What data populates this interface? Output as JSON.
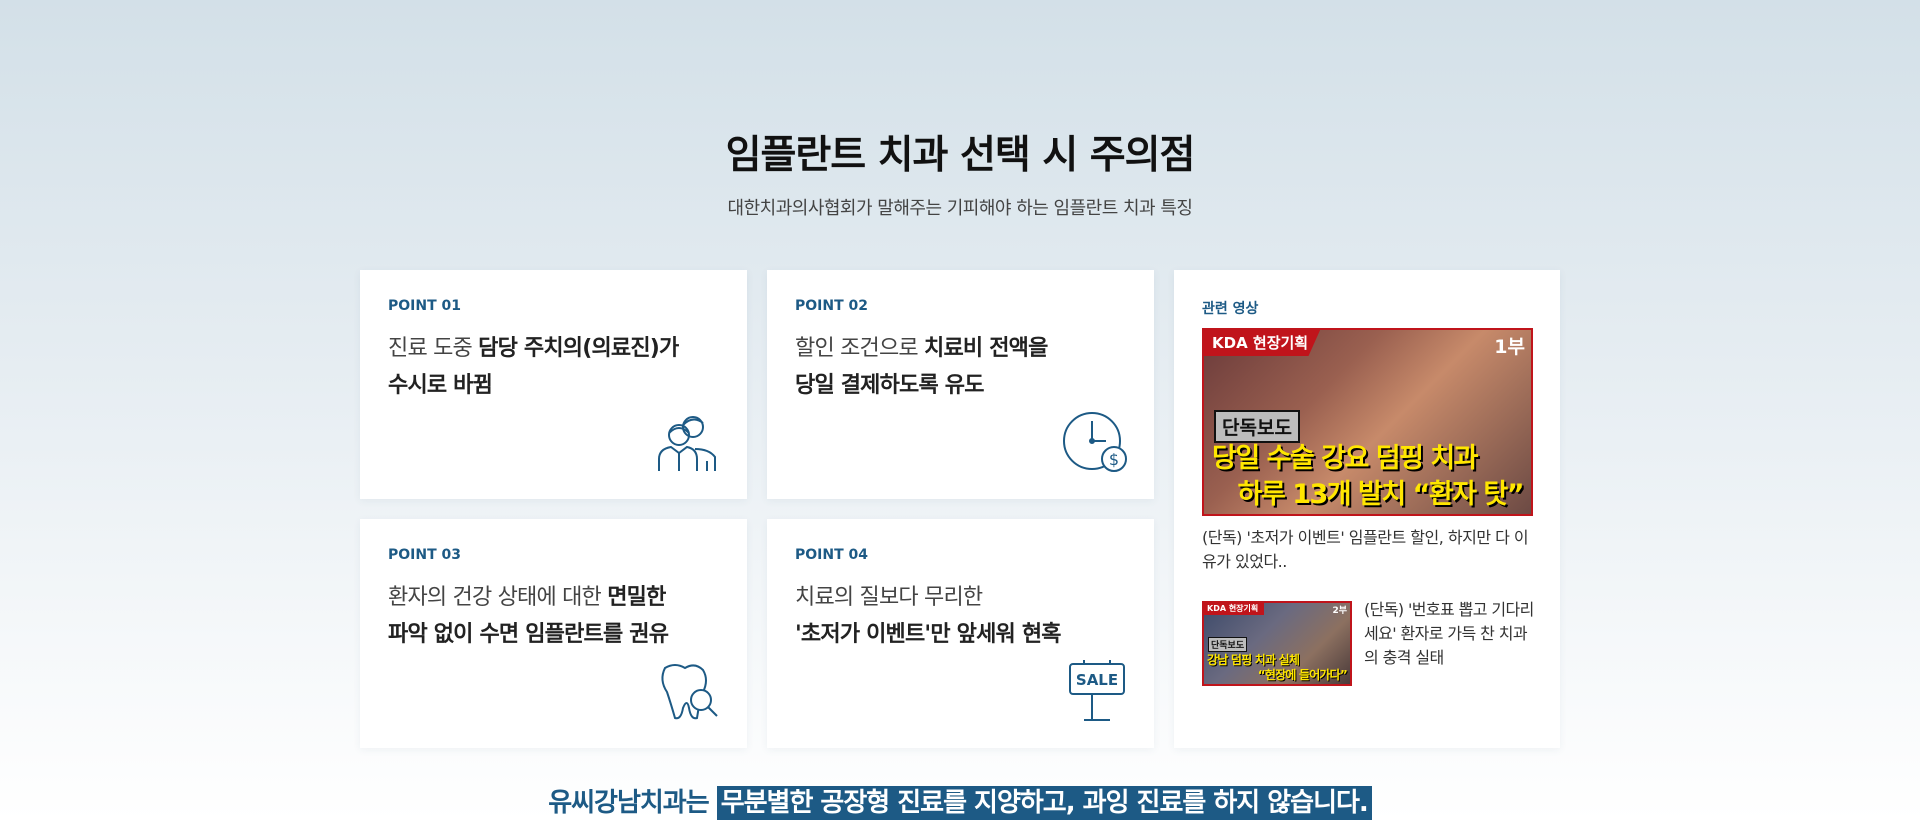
{
  "section": {
    "title": "임플란트 치과 선택 시 주의점",
    "subtitle": "대한치과의사협회가 말해주는 기피해야 하는 임플란트 치과 특징"
  },
  "points": [
    {
      "tag": "POINT 01",
      "line1_normal": "진료 도중 ",
      "line1_bold": "담당 주치의(의료진)가",
      "line2_bold": "수시로 바뀜",
      "icon": "doctors-icon"
    },
    {
      "tag": "POINT 02",
      "line1_normal": "할인 조건으로 ",
      "line1_bold": "치료비 전액을",
      "line2_bold": "당일 결제하도록 유도",
      "icon": "clock-dollar-icon"
    },
    {
      "tag": "POINT 03",
      "line1_normal": "환자의 건강 상태에 대한 ",
      "line1_bold": "면밀한",
      "line2_bold": "파악 없이 수면 임플란트를 권유",
      "icon": "tooth-magnifier-icon"
    },
    {
      "tag": "POINT 04",
      "line1_normal": "치료의 질보다 무리한",
      "line1_bold": "",
      "line2_bold": "'초저가 이벤트'만 앞세워 현혹",
      "icon": "sale-sign-icon",
      "sale_text": "SALE"
    }
  ],
  "videos": {
    "tag": "관련 영상",
    "main": {
      "badge": "KDA 현장기획",
      "part": "1부",
      "exclusive": "단독보도",
      "headline1": "당일 수술 강요 덤핑 치과",
      "headline2": "하루 13개 발치 “환자 탓”",
      "caption": "(단독) '초저가 이벤트' 임플란트 할인, 하지만 다 이유가 있었다.."
    },
    "secondary": {
      "badge": "KDA 현장기획",
      "part": "2부",
      "exclusive": "단독보도",
      "headline1": "강남 덤핑 치과 실체",
      "headline2": "“현장에 들어가다”",
      "caption": "(단독) '번호표 뽑고 기다리세요' 환자로 가득 찬 치과의 충격 실태"
    }
  },
  "bottom": {
    "prefix": "유씨강남치과는 ",
    "highlight": "무분별한 공장형 진료를 지양하고, 과잉 진료를 하지 않습니다."
  },
  "colors": {
    "accent": "#1d5a85",
    "thumb_red": "#c0141b",
    "thumb_yellow": "#ffe600"
  }
}
